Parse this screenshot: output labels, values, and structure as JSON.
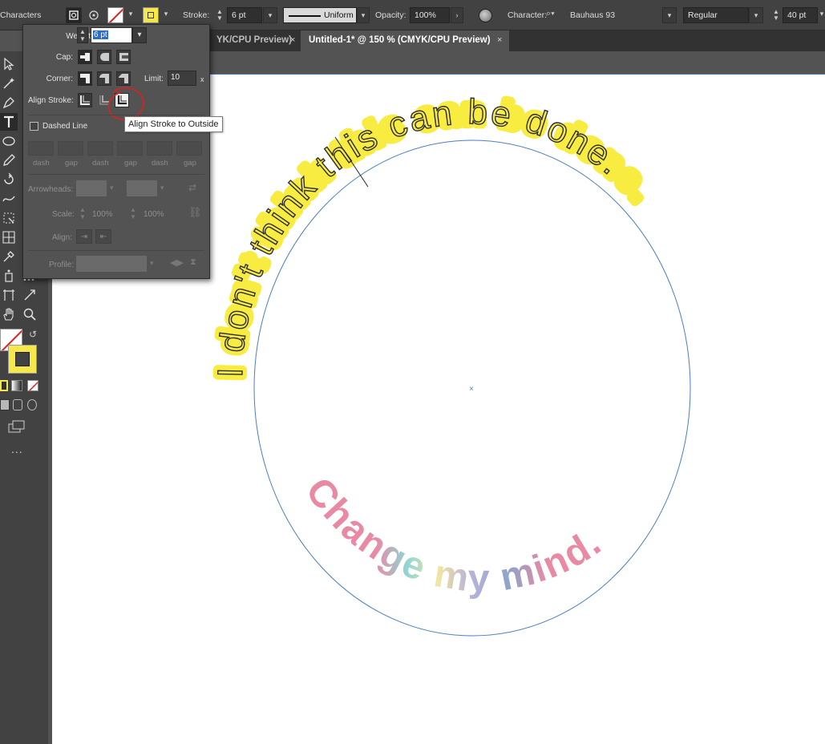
{
  "control_bar": {
    "panel_name": "Characters",
    "stroke_label": "Stroke:",
    "stroke_weight": "6 pt",
    "stroke_profile": "Uniform",
    "opacity_label": "Opacity:",
    "opacity_value": "100%",
    "character_label": "Character:",
    "font_search_icon": "search-icon",
    "font_family": "Bauhaus 93",
    "font_style": "Regular",
    "font_size": "40 pt",
    "fill_color": "#f4e84a",
    "stroke_none_color": "#ff0000"
  },
  "tabs": [
    {
      "label": "YK/CPU Preview)",
      "close": "×"
    },
    {
      "label": "Untitled-1* @ 150 % (CMYK/CPU Preview)",
      "close": "×"
    }
  ],
  "stroke_panel": {
    "weight_label": "Weight:",
    "weight_value": "6 pt",
    "cap_label": "Cap:",
    "corner_label": "Corner:",
    "limit_label": "Limit:",
    "limit_value": "10",
    "limit_unit": "x",
    "align_stroke_label": "Align Stroke:",
    "dashed_line_label": "Dashed Line",
    "dashed_line_checked": false,
    "dash_labels": [
      "dash",
      "gap",
      "dash",
      "gap",
      "dash",
      "gap"
    ],
    "arrowheads_label": "Arrowheads:",
    "scale_label": "Scale:",
    "scale_start": "100%",
    "scale_end": "100%",
    "align_label": "Align:",
    "profile_label": "Profile:",
    "tooltip": "Align Stroke to Outside"
  },
  "artwork": {
    "top_text": "I don't think this can be done.",
    "bottom_text": "Change my mind.",
    "top_text_color": "#2b2b3a",
    "top_highlight_color": "#f7ec3f",
    "bottom_text_color": "#e98aa5",
    "bottom_stripe_colors": [
      "#8fd5d4",
      "#b9b3d9",
      "#f2e6a1"
    ],
    "circle_color": "#4a7fc1",
    "annotation_color": "#e0201a"
  },
  "toolbar": {
    "fill_color": "#f4e84a",
    "more_tools_label": "..."
  }
}
